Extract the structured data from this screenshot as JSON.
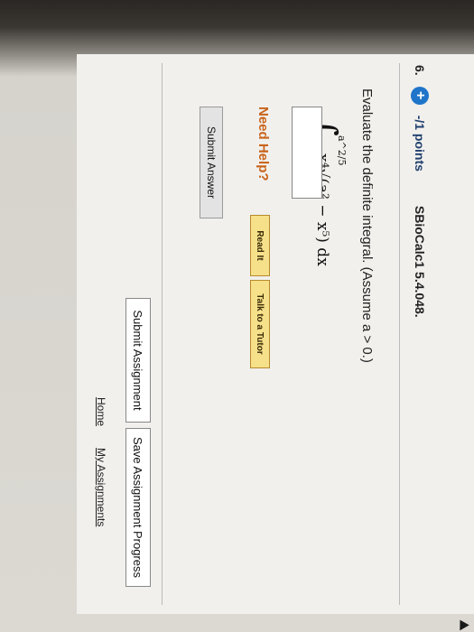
{
  "question": {
    "number": "6.",
    "points_label": "-/1 points",
    "code": "SBioCalc1 5.4.048.",
    "prompt": "Evaluate the definite integral. (Assume a > 0.)",
    "integral": {
      "upper_limit": "a^2/5",
      "lower_limit": "0",
      "integrand": "x⁴√(a² − x⁵) dx"
    },
    "answer_value": ""
  },
  "help": {
    "label": "Need Help?",
    "read_it": "Read It",
    "talk_tutor": "Talk to a Tutor"
  },
  "buttons": {
    "submit_answer": "Submit Answer",
    "submit_assignment": "Submit Assignment",
    "save_progress": "Save Assignment Progress"
  },
  "links": {
    "home": "Home",
    "my_assignments": "My Assignments"
  },
  "colors": {
    "badge": "#1f75c9",
    "need_help": "#c9631b",
    "help_button": "#f6e08a"
  }
}
